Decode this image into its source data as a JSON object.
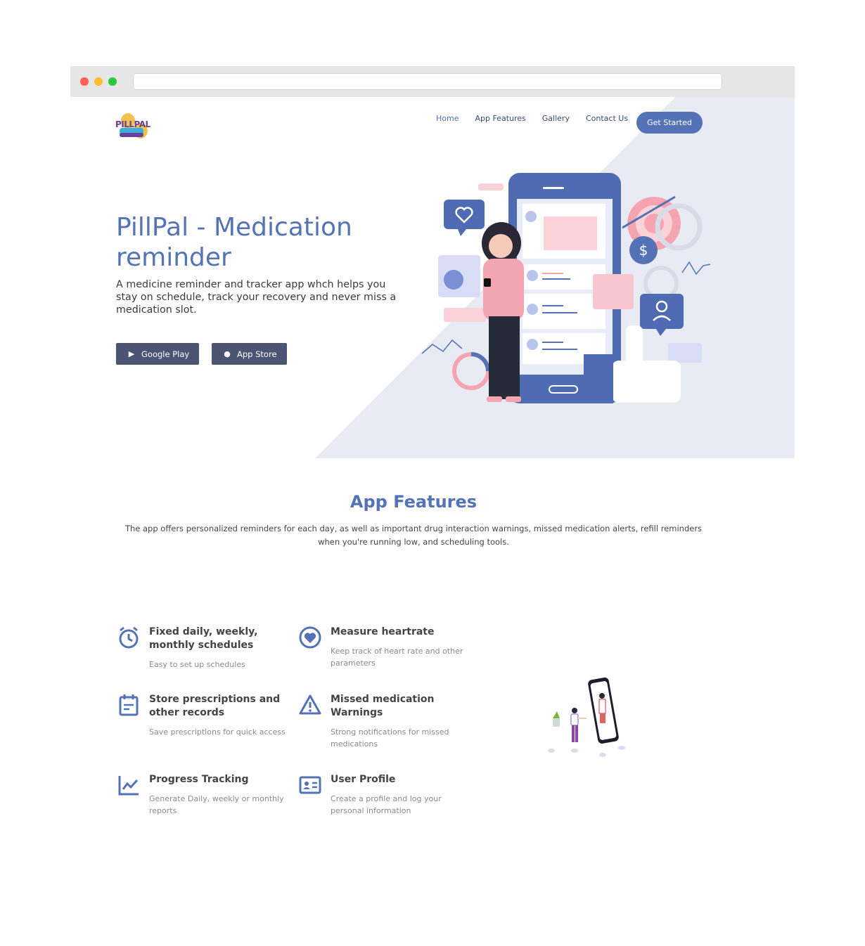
{
  "nav": {
    "logo_text": "PILLPAL",
    "links": [
      "Home",
      "App Features",
      "Gallery",
      "Contact Us"
    ],
    "cta": "Get Started"
  },
  "hero": {
    "title": "PillPal - Medication reminder",
    "description": "A medicine reminder and tracker app whch helps you stay on schedule, track your recovery and never miss a medication slot.",
    "google_play": "Google Play",
    "app_store": "App Store"
  },
  "features": {
    "title": "App Features",
    "description": "The app offers personalized reminders for each day, as well as important drug interaction warnings, missed medication alerts, refill reminders when you're running low, and scheduling tools.",
    "items": [
      {
        "icon": "alarm-clock-icon",
        "title": "Fixed daily, weekly, monthly schedules",
        "text": "Easy to set up schedules"
      },
      {
        "icon": "heart-icon",
        "title": "Measure heartrate",
        "text": "Keep track of heart rate and other parameters"
      },
      {
        "icon": "calendar-icon",
        "title": "Store prescriptions and other records",
        "text": "Save prescriptions for quick access"
      },
      {
        "icon": "warning-icon",
        "title": "Missed medication Warnings",
        "text": "Strong notifications for missed medications"
      },
      {
        "icon": "chart-line-icon",
        "title": "Progress Tracking",
        "text": "Generate Daily, weekly or monthly reports"
      },
      {
        "icon": "id-card-icon",
        "title": "User Profile",
        "text": "Create a profile and log your personal information"
      }
    ]
  },
  "colors": {
    "accent": "#5472b6",
    "button_dark": "#4b5573",
    "hero_bg": "#e8ebf4"
  }
}
